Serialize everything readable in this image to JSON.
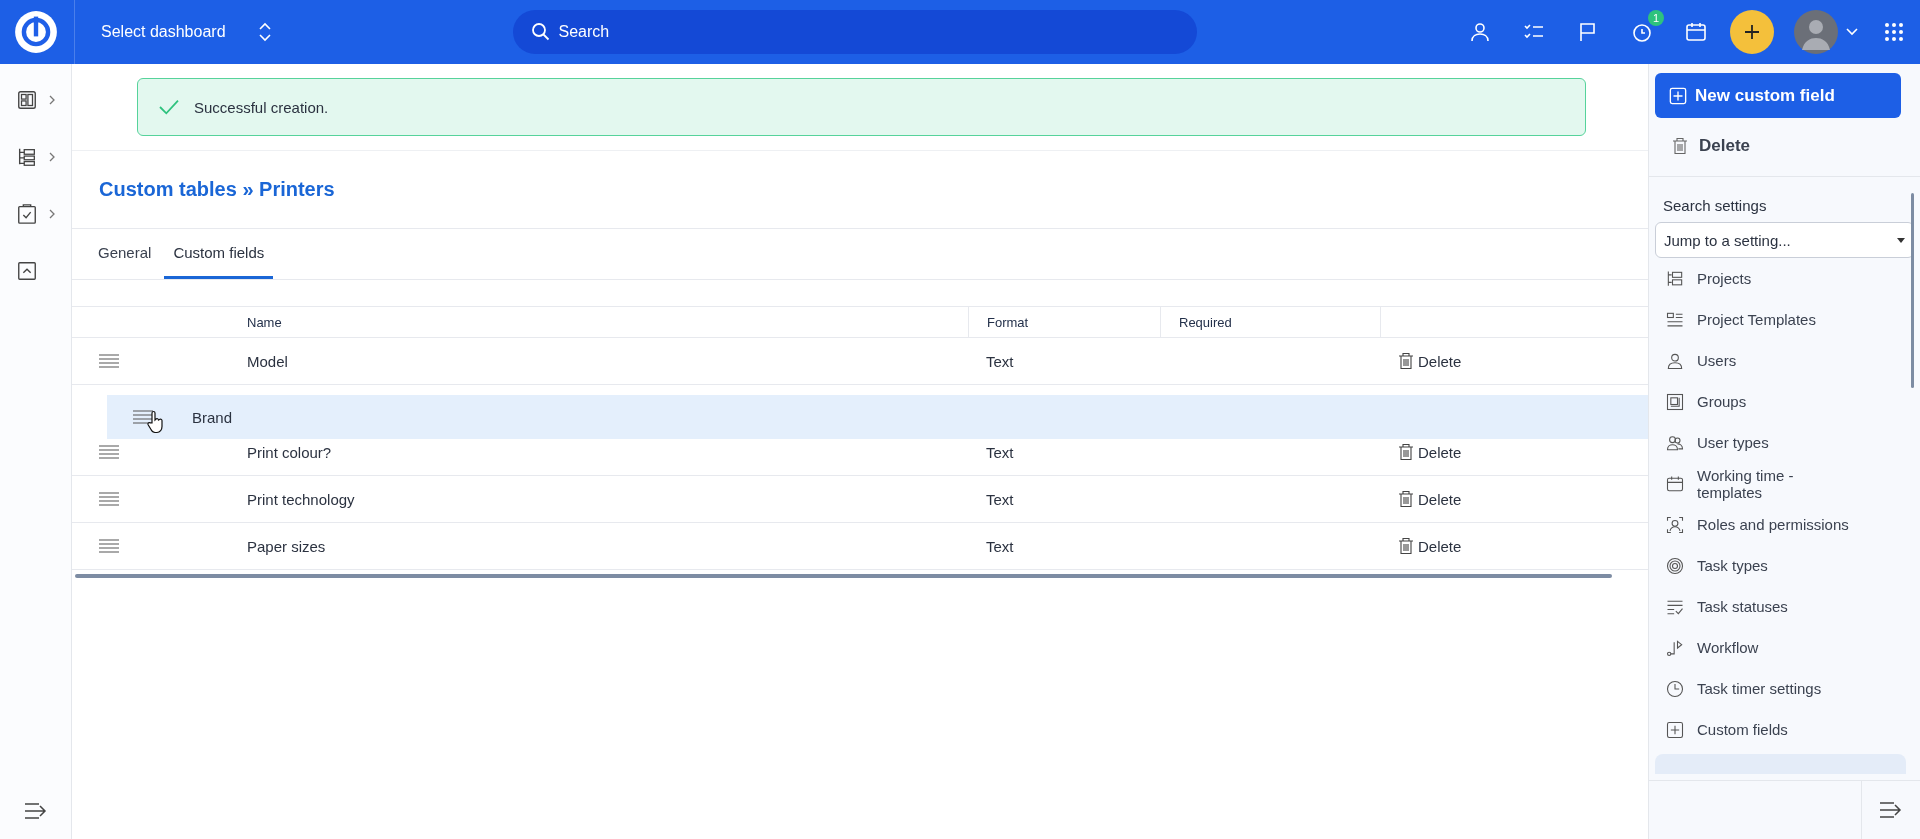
{
  "topbar": {
    "dashboard_select": "Select dashboard",
    "search": {
      "placeholder": "Search"
    },
    "timer_badge": "1"
  },
  "alert": {
    "text": "Successful creation."
  },
  "breadcrumb": {
    "parent": "Custom tables",
    "separator": "»",
    "current": "Printers"
  },
  "tabs": [
    {
      "label": "General",
      "selected": false
    },
    {
      "label": "Custom fields",
      "selected": true
    }
  ],
  "table": {
    "columns": [
      "Name",
      "Format",
      "Required"
    ],
    "rows": [
      {
        "name": "Model",
        "format": "Text",
        "action": "Delete",
        "dragging": false
      },
      {
        "name": "Brand",
        "dragging": true
      },
      {
        "name": "Print colour?",
        "format": "Text",
        "action": "Delete",
        "dragging": false
      },
      {
        "name": "Print technology",
        "format": "Text",
        "action": "Delete",
        "dragging": false
      },
      {
        "name": "Paper sizes",
        "format": "Text",
        "action": "Delete",
        "dragging": false
      }
    ]
  },
  "actions": {
    "primary": "New custom field",
    "delete": "Delete"
  },
  "settings": {
    "label": "Search settings",
    "jump_placeholder": "Jump to a setting...",
    "items": [
      {
        "label": "Projects",
        "kind": "projects"
      },
      {
        "label": "Project Templates",
        "kind": "templates"
      },
      {
        "label": "Users",
        "kind": "user"
      },
      {
        "label": "Groups",
        "kind": "groups"
      },
      {
        "label": "User types",
        "kind": "usertypes"
      },
      {
        "label": "Working time - templates",
        "kind": "calendar"
      },
      {
        "label": "Roles and permissions",
        "kind": "roles"
      },
      {
        "label": "Task types",
        "kind": "target"
      },
      {
        "label": "Task statuses",
        "kind": "statuses"
      },
      {
        "label": "Workflow",
        "kind": "workflow"
      },
      {
        "label": "Task timer settings",
        "kind": "clock"
      },
      {
        "label": "Custom fields",
        "kind": "plus"
      }
    ]
  }
}
